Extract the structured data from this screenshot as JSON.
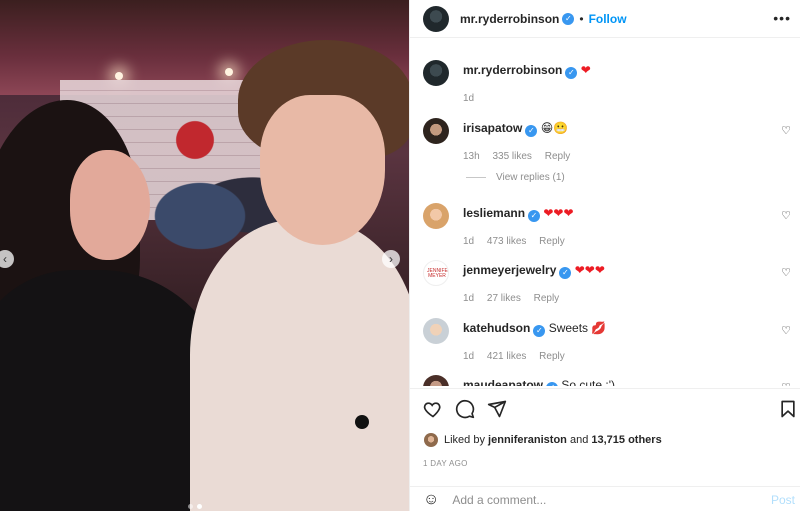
{
  "post": {
    "author": "mr.ryderrobinson",
    "follow_label": "Follow",
    "more_label": "•••",
    "caption_emoji": "❤",
    "caption_time": "1d"
  },
  "comments": [
    {
      "user": "irisapatow",
      "text": "😁😬",
      "time": "13h",
      "likes": "335 likes",
      "reply": "Reply",
      "view_replies": "View replies (1)"
    },
    {
      "user": "lesliemann",
      "text": "❤❤❤",
      "time": "1d",
      "likes": "473 likes",
      "reply": "Reply"
    },
    {
      "user": "jenmeyerjewelry",
      "text": "❤❤❤",
      "time": "1d",
      "likes": "27 likes",
      "reply": "Reply",
      "avatar_text": "JENNIFER MEYER"
    },
    {
      "user": "katehudson",
      "text": "Sweets 💋",
      "time": "1d",
      "likes": "421 likes",
      "reply": "Reply"
    },
    {
      "user": "maudeapatow",
      "text": "So cute :')"
    }
  ],
  "likes_summary": {
    "prefix": "Liked by",
    "user": "jenniferaniston",
    "and": "and",
    "count": "13,715 others"
  },
  "date_label": "1 DAY AGO",
  "add_comment": {
    "placeholder": "Add a comment...",
    "post_label": "Post"
  },
  "icons": {
    "like": "heart-icon",
    "comment": "comment-icon",
    "share": "send-icon",
    "save": "bookmark-icon",
    "emoji": "smile-icon",
    "nav_prev": "chevron-left-icon",
    "nav_next": "chevron-right-icon"
  },
  "colors": {
    "link_blue": "#0095f6",
    "verified_blue": "#3897f0",
    "muted": "#8e8e8e",
    "heart_red": "#ed1c24"
  }
}
